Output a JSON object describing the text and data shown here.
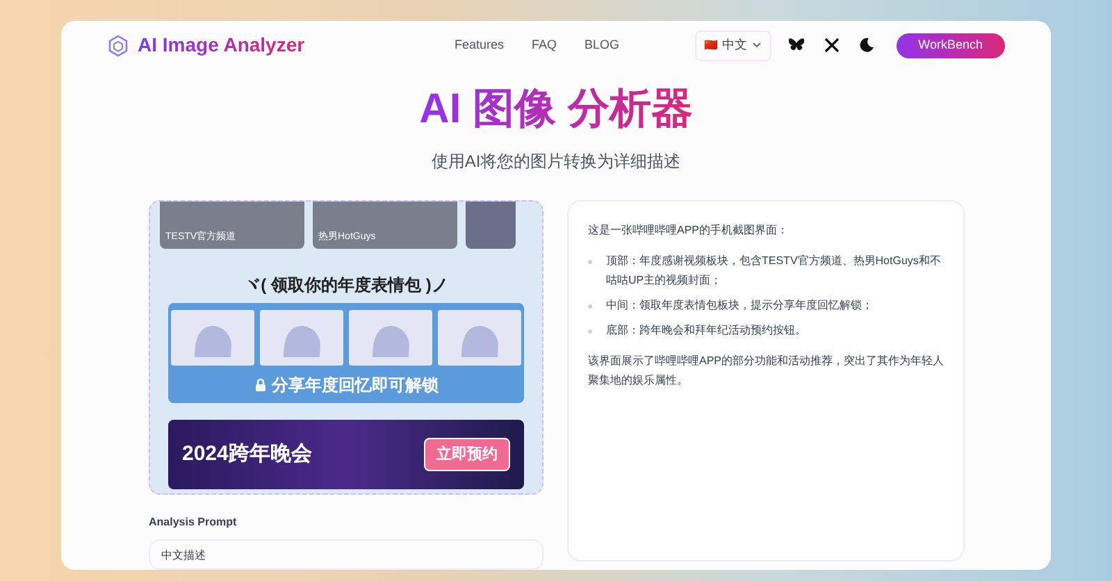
{
  "header": {
    "logo_text": "AI Image Analyzer",
    "nav": [
      {
        "label": "Features"
      },
      {
        "label": "FAQ"
      },
      {
        "label": "BLOG"
      }
    ],
    "language": {
      "flag": "🇨🇳",
      "label": "中文"
    },
    "cta": "WorkBench"
  },
  "hero": {
    "title": "AI 图像 分析器",
    "subtitle": "使用AI将您的图片转换为详细描述"
  },
  "image_preview": {
    "thumbnails": [
      {
        "caption": "TESTV官方频道"
      },
      {
        "caption": "热男HotGuys"
      }
    ],
    "sticker_heading": "ヾ( 领取你的年度表情包 )ノ",
    "unlock_text": "分享年度回忆即可解锁",
    "banner_title": "2024跨年晚会",
    "banner_button": "立即预约"
  },
  "prompt": {
    "label": "Analysis Prompt",
    "value": "中文描述"
  },
  "result": {
    "intro": "这是一张哔哩哔哩APP的手机截图界面：",
    "points": [
      "顶部：年度感谢视频板块，包含TESTV官方频道、热男HotGuys和不咕咕UP主的视频封面；",
      "中间：领取年度表情包板块，提示分享年度回忆解锁；",
      "底部：跨年晚会和拜年纪活动预约按钮。"
    ],
    "summary": "该界面展示了哔哩哔哩APP的部分功能和活动推荐，突出了其作为年轻人聚集地的娱乐属性。"
  }
}
